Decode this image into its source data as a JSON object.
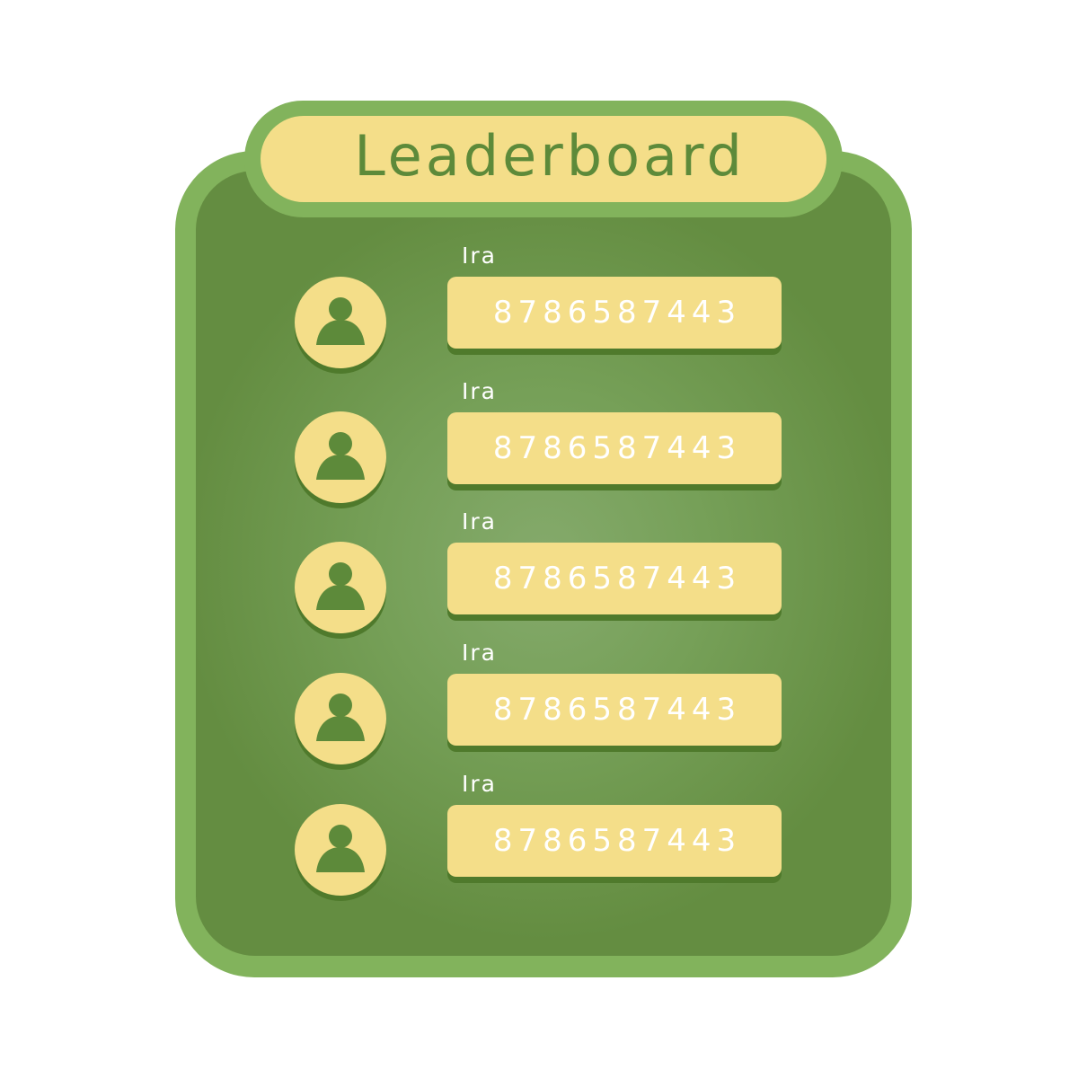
{
  "title": "Leaderboard",
  "colors": {
    "frame": "#82b35c",
    "panel": "#6b9448",
    "accent": "#f4de89",
    "title_text": "#5d8a3a",
    "shadow": "#4f7a2c"
  },
  "entries": [
    {
      "name": "Ira",
      "score": "8786587443",
      "icon": "user-avatar-icon"
    },
    {
      "name": "Ira",
      "score": "8786587443",
      "icon": "user-avatar-icon"
    },
    {
      "name": "Ira",
      "score": "8786587443",
      "icon": "user-avatar-icon"
    },
    {
      "name": "Ira",
      "score": "8786587443",
      "icon": "user-avatar-icon"
    },
    {
      "name": "Ira",
      "score": "8786587443",
      "icon": "user-avatar-icon"
    }
  ]
}
